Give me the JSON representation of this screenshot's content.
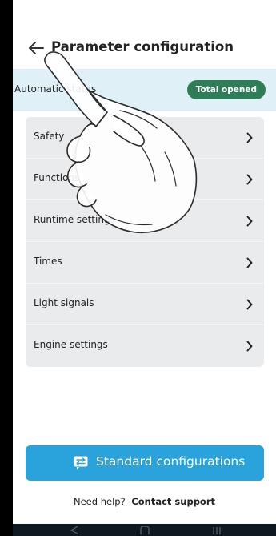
{
  "header": {
    "back_icon": "arrow-left-icon",
    "title": "Parameter configuration"
  },
  "status": {
    "label": "Automatic status",
    "badge": "Total opened",
    "badge_color": "#2e7d57",
    "background": "#dff0f7"
  },
  "menu": {
    "items": [
      {
        "label": "Safety",
        "icon": "chevron-right-icon"
      },
      {
        "label": "Functions",
        "icon": "chevron-right-icon"
      },
      {
        "label": "Runtime settings",
        "icon": "chevron-right-icon"
      },
      {
        "label": "Times",
        "icon": "chevron-right-icon"
      },
      {
        "label": "Light signals",
        "icon": "chevron-right-icon"
      },
      {
        "label": "Engine settings",
        "icon": "chevron-right-icon"
      }
    ]
  },
  "actions": {
    "primary_label": "Standard configurations",
    "primary_icon": "configuration-list-icon",
    "primary_color": "#2aa3dc"
  },
  "help": {
    "text": "Need help?",
    "link": "Contact support"
  },
  "navbar": {
    "icons": [
      "back-nav-icon",
      "home-nav-icon",
      "recents-nav-icon"
    ]
  }
}
